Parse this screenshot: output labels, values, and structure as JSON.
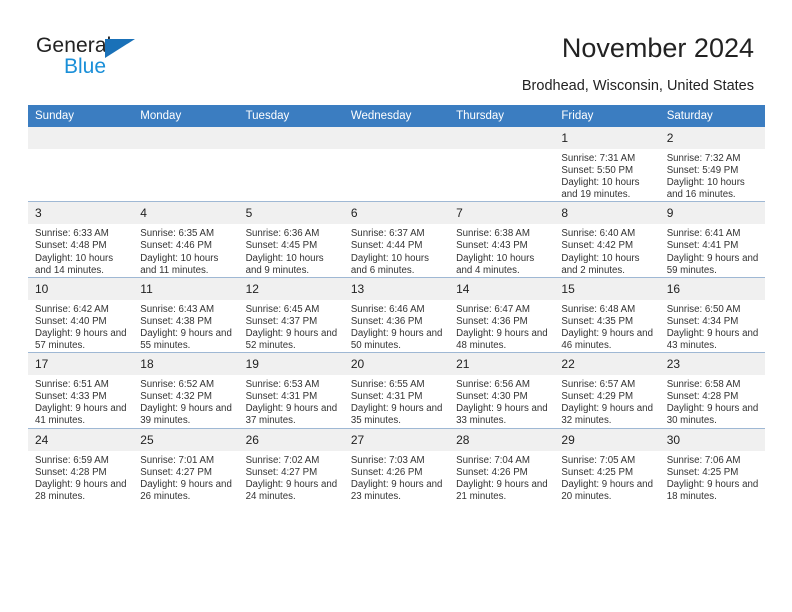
{
  "brand": {
    "name_part1": "General",
    "name_part2": "Blue",
    "triangle_color": "#1a71b8",
    "blue_color": "#1a8fd8"
  },
  "header": {
    "title": "November 2024",
    "subtitle": "Brodhead, Wisconsin, United States"
  },
  "calendar": {
    "header_bg": "#3b7dc1",
    "daynum_bg": "#f0f0f0",
    "weekdays": [
      "Sunday",
      "Monday",
      "Tuesday",
      "Wednesday",
      "Thursday",
      "Friday",
      "Saturday"
    ],
    "weeks": [
      [
        {
          "day": "",
          "lines": []
        },
        {
          "day": "",
          "lines": []
        },
        {
          "day": "",
          "lines": []
        },
        {
          "day": "",
          "lines": []
        },
        {
          "day": "",
          "lines": []
        },
        {
          "day": "1",
          "lines": [
            "Sunrise: 7:31 AM",
            "Sunset: 5:50 PM",
            "Daylight: 10 hours and 19 minutes."
          ]
        },
        {
          "day": "2",
          "lines": [
            "Sunrise: 7:32 AM",
            "Sunset: 5:49 PM",
            "Daylight: 10 hours and 16 minutes."
          ]
        }
      ],
      [
        {
          "day": "3",
          "lines": [
            "Sunrise: 6:33 AM",
            "Sunset: 4:48 PM",
            "Daylight: 10 hours and 14 minutes."
          ]
        },
        {
          "day": "4",
          "lines": [
            "Sunrise: 6:35 AM",
            "Sunset: 4:46 PM",
            "Daylight: 10 hours and 11 minutes."
          ]
        },
        {
          "day": "5",
          "lines": [
            "Sunrise: 6:36 AM",
            "Sunset: 4:45 PM",
            "Daylight: 10 hours and 9 minutes."
          ]
        },
        {
          "day": "6",
          "lines": [
            "Sunrise: 6:37 AM",
            "Sunset: 4:44 PM",
            "Daylight: 10 hours and 6 minutes."
          ]
        },
        {
          "day": "7",
          "lines": [
            "Sunrise: 6:38 AM",
            "Sunset: 4:43 PM",
            "Daylight: 10 hours and 4 minutes."
          ]
        },
        {
          "day": "8",
          "lines": [
            "Sunrise: 6:40 AM",
            "Sunset: 4:42 PM",
            "Daylight: 10 hours and 2 minutes."
          ]
        },
        {
          "day": "9",
          "lines": [
            "Sunrise: 6:41 AM",
            "Sunset: 4:41 PM",
            "Daylight: 9 hours and 59 minutes."
          ]
        }
      ],
      [
        {
          "day": "10",
          "lines": [
            "Sunrise: 6:42 AM",
            "Sunset: 4:40 PM",
            "Daylight: 9 hours and 57 minutes."
          ]
        },
        {
          "day": "11",
          "lines": [
            "Sunrise: 6:43 AM",
            "Sunset: 4:38 PM",
            "Daylight: 9 hours and 55 minutes."
          ]
        },
        {
          "day": "12",
          "lines": [
            "Sunrise: 6:45 AM",
            "Sunset: 4:37 PM",
            "Daylight: 9 hours and 52 minutes."
          ]
        },
        {
          "day": "13",
          "lines": [
            "Sunrise: 6:46 AM",
            "Sunset: 4:36 PM",
            "Daylight: 9 hours and 50 minutes."
          ]
        },
        {
          "day": "14",
          "lines": [
            "Sunrise: 6:47 AM",
            "Sunset: 4:36 PM",
            "Daylight: 9 hours and 48 minutes."
          ]
        },
        {
          "day": "15",
          "lines": [
            "Sunrise: 6:48 AM",
            "Sunset: 4:35 PM",
            "Daylight: 9 hours and 46 minutes."
          ]
        },
        {
          "day": "16",
          "lines": [
            "Sunrise: 6:50 AM",
            "Sunset: 4:34 PM",
            "Daylight: 9 hours and 43 minutes."
          ]
        }
      ],
      [
        {
          "day": "17",
          "lines": [
            "Sunrise: 6:51 AM",
            "Sunset: 4:33 PM",
            "Daylight: 9 hours and 41 minutes."
          ]
        },
        {
          "day": "18",
          "lines": [
            "Sunrise: 6:52 AM",
            "Sunset: 4:32 PM",
            "Daylight: 9 hours and 39 minutes."
          ]
        },
        {
          "day": "19",
          "lines": [
            "Sunrise: 6:53 AM",
            "Sunset: 4:31 PM",
            "Daylight: 9 hours and 37 minutes."
          ]
        },
        {
          "day": "20",
          "lines": [
            "Sunrise: 6:55 AM",
            "Sunset: 4:31 PM",
            "Daylight: 9 hours and 35 minutes."
          ]
        },
        {
          "day": "21",
          "lines": [
            "Sunrise: 6:56 AM",
            "Sunset: 4:30 PM",
            "Daylight: 9 hours and 33 minutes."
          ]
        },
        {
          "day": "22",
          "lines": [
            "Sunrise: 6:57 AM",
            "Sunset: 4:29 PM",
            "Daylight: 9 hours and 32 minutes."
          ]
        },
        {
          "day": "23",
          "lines": [
            "Sunrise: 6:58 AM",
            "Sunset: 4:28 PM",
            "Daylight: 9 hours and 30 minutes."
          ]
        }
      ],
      [
        {
          "day": "24",
          "lines": [
            "Sunrise: 6:59 AM",
            "Sunset: 4:28 PM",
            "Daylight: 9 hours and 28 minutes."
          ]
        },
        {
          "day": "25",
          "lines": [
            "Sunrise: 7:01 AM",
            "Sunset: 4:27 PM",
            "Daylight: 9 hours and 26 minutes."
          ]
        },
        {
          "day": "26",
          "lines": [
            "Sunrise: 7:02 AM",
            "Sunset: 4:27 PM",
            "Daylight: 9 hours and 24 minutes."
          ]
        },
        {
          "day": "27",
          "lines": [
            "Sunrise: 7:03 AM",
            "Sunset: 4:26 PM",
            "Daylight: 9 hours and 23 minutes."
          ]
        },
        {
          "day": "28",
          "lines": [
            "Sunrise: 7:04 AM",
            "Sunset: 4:26 PM",
            "Daylight: 9 hours and 21 minutes."
          ]
        },
        {
          "day": "29",
          "lines": [
            "Sunrise: 7:05 AM",
            "Sunset: 4:25 PM",
            "Daylight: 9 hours and 20 minutes."
          ]
        },
        {
          "day": "30",
          "lines": [
            "Sunrise: 7:06 AM",
            "Sunset: 4:25 PM",
            "Daylight: 9 hours and 18 minutes."
          ]
        }
      ]
    ]
  }
}
